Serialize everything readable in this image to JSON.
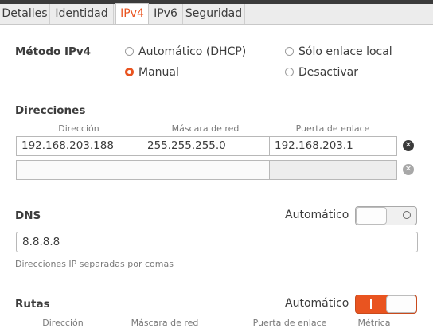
{
  "tabs": [
    {
      "label": "Detalles"
    },
    {
      "label": "Identidad"
    },
    {
      "label": "IPv4"
    },
    {
      "label": "IPv6"
    },
    {
      "label": "Seguridad"
    }
  ],
  "active_tab": "IPv4",
  "method": {
    "label": "Método IPv4",
    "options": [
      {
        "label": "Automático (DHCP)",
        "selected": false
      },
      {
        "label": "Sólo enlace local",
        "selected": false
      },
      {
        "label": "Manual",
        "selected": true
      },
      {
        "label": "Desactivar",
        "selected": false
      }
    ]
  },
  "addresses": {
    "title": "Direcciones",
    "columns": [
      "Dirección",
      "Máscara de red",
      "Puerta de enlace"
    ],
    "rows": [
      [
        "192.168.203.188",
        "255.255.255.0",
        "192.168.203.1"
      ],
      [
        "",
        "",
        ""
      ]
    ]
  },
  "dns": {
    "title": "DNS",
    "auto_label": "Automático",
    "auto_on": false,
    "value": "8.8.8.8",
    "hint": "Direcciones IP separadas por comas"
  },
  "routes": {
    "title": "Rutas",
    "auto_label": "Automático",
    "auto_on": true,
    "columns": [
      "Dirección",
      "Máscara de red",
      "Puerta de enlace",
      "Métrica"
    ]
  },
  "colors": {
    "accent": "#e95420",
    "text": "#3c3c3c",
    "border": "#b8b8b8"
  }
}
